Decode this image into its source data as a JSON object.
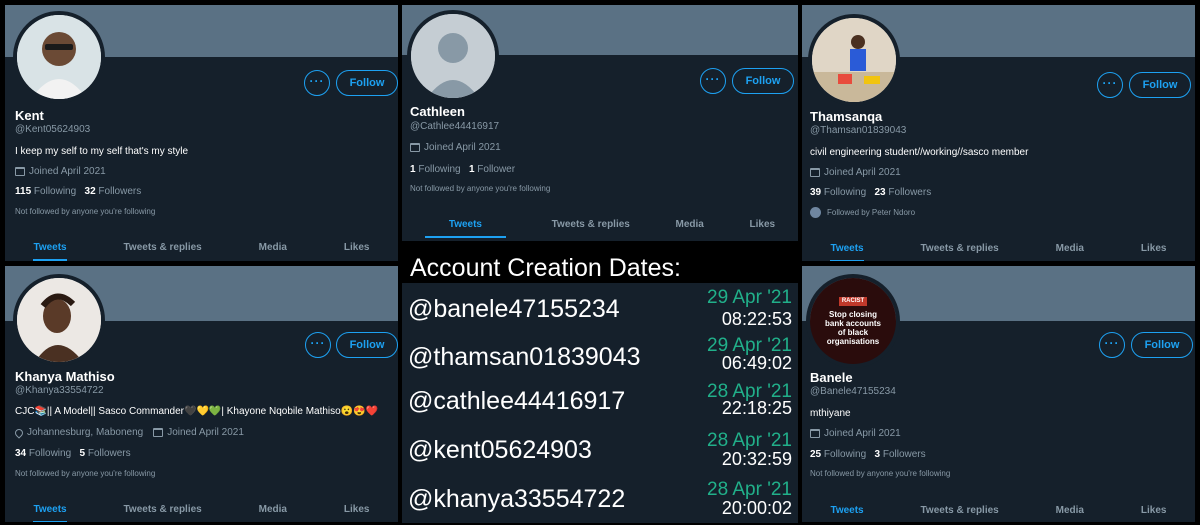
{
  "ui": {
    "follow_label": "Follow",
    "more_label": "···"
  },
  "profiles": [
    {
      "name": "Kent",
      "handle": "@Kent05624903",
      "bio": "I keep my self to my self that's my style",
      "location": "",
      "joined": "Joined April 2021",
      "following_count": "115",
      "following_label": "Following",
      "followers_count": "32",
      "followers_label": "Followers",
      "follow_note": "Not followed by anyone you're following",
      "tabs": [
        "Tweets",
        "Tweets & replies",
        "Media",
        "Likes"
      ]
    },
    {
      "name": "Cathleen",
      "handle": "@Cathlee44416917",
      "bio": "",
      "location": "",
      "joined": "Joined April 2021",
      "following_count": "1",
      "following_label": "Following",
      "followers_count": "1",
      "followers_label": "Follower",
      "follow_note": "Not followed by anyone you're following",
      "tabs": [
        "Tweets",
        "Tweets & replies",
        "Media",
        "Likes"
      ]
    },
    {
      "name": "Thamsanqa",
      "handle": "@Thamsan01839043",
      "bio": "civil engineering student//working//sasco member",
      "location": "",
      "joined": "Joined April 2021",
      "following_count": "39",
      "following_label": "Following",
      "followers_count": "23",
      "followers_label": "Followers",
      "follow_note": "Followed by Peter Ndoro",
      "tabs": [
        "Tweets",
        "Tweets & replies",
        "Media",
        "Likes"
      ]
    },
    {
      "name": "Khanya Mathiso",
      "handle": "@Khanya33554722",
      "bio": "CJC📚|| A Model|| Sasco Commander🖤💛💚| Khayone Nqobile Mathiso😮😍❤️",
      "location": "Johannesburg, Maboneng",
      "joined": "Joined April 2021",
      "following_count": "34",
      "following_label": "Following",
      "followers_count": "5",
      "followers_label": "Followers",
      "follow_note": "Not followed by anyone you're following",
      "tabs": [
        "Tweets",
        "Tweets & replies",
        "Media",
        "Likes"
      ]
    },
    {
      "name": "Banele",
      "handle": "@Banele47155234",
      "bio": "mthiyane",
      "location": "",
      "joined": "Joined April 2021",
      "following_count": "25",
      "following_label": "Following",
      "followers_count": "3",
      "followers_label": "Followers",
      "follow_note": "Not followed by anyone you're following",
      "tabs": [
        "Tweets",
        "Tweets & replies",
        "Media",
        "Likes"
      ],
      "avatar_text": [
        "RACIST",
        "Stop closing",
        "bank accounts",
        "of black",
        "organisations"
      ]
    }
  ],
  "creation": {
    "title": "Account Creation Dates:",
    "rows": [
      {
        "handle": "@banele47155234",
        "date": "29 Apr '21",
        "time": "08:22:53"
      },
      {
        "handle": "@thamsan01839043",
        "date": "29 Apr '21",
        "time": "06:49:02"
      },
      {
        "handle": "@cathlee44416917",
        "date": "28 Apr '21",
        "time": "22:18:25"
      },
      {
        "handle": "@kent05624903",
        "date": "28 Apr '21",
        "time": "20:32:59"
      },
      {
        "handle": "@khanya33554722",
        "date": "28 Apr '21",
        "time": "20:00:02"
      }
    ]
  },
  "colors": {
    "background": "#15202b",
    "banner": "#5a7184",
    "accent": "#1da1f2",
    "date_green": "#21b08a",
    "muted": "#8899a6"
  }
}
